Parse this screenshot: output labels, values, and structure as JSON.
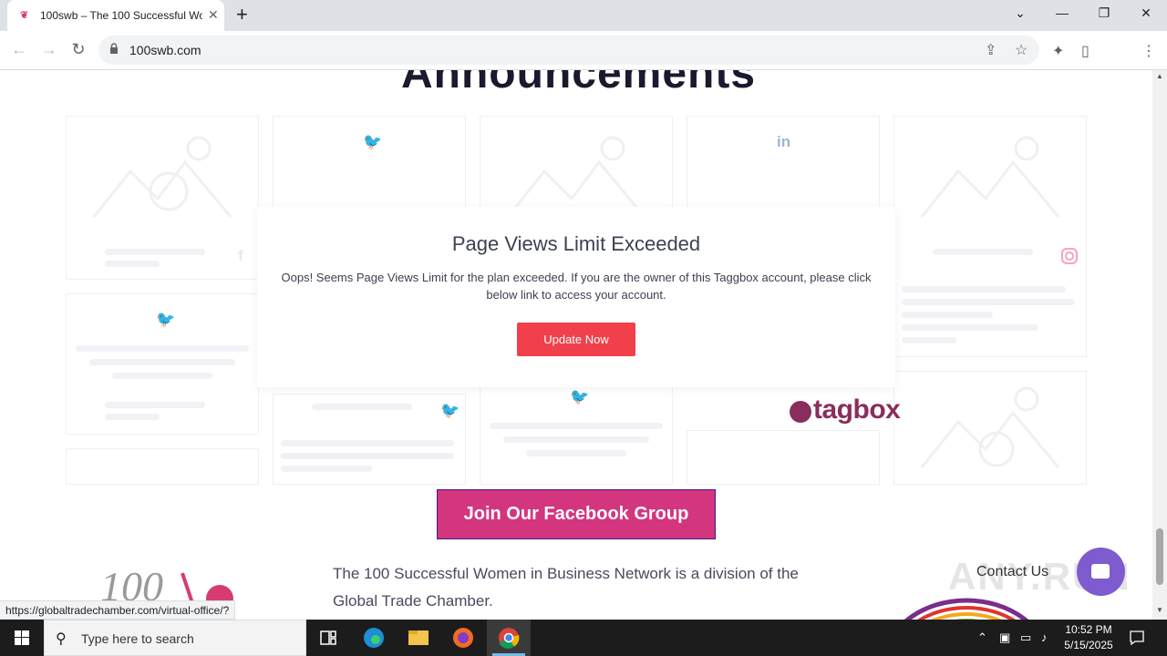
{
  "browser": {
    "tab_title": "100swb – The 100 Successful Wo",
    "tab_close": "✕",
    "new_tab": "+",
    "url": "100swb.com",
    "window": {
      "dropdown": "⌄",
      "minimize": "—",
      "restore": "❐",
      "close": "✕"
    },
    "nav": {
      "back": "←",
      "forward": "→",
      "reload": "↻"
    },
    "toolbar": {
      "share": "⇪",
      "bookmark": "☆",
      "extensions": "✦",
      "sidepanel": "▯",
      "menu": "⋮"
    }
  },
  "page": {
    "heading_fragment": "Announcements",
    "modal": {
      "title": "Page Views Limit Exceeded",
      "message": "Oops! Seems Page Views Limit for the plan exceeded. If you are the owner of this Taggbox account, please click below link to access your account.",
      "button": "Update Now"
    },
    "tagbox_logo": "tagbox",
    "facebook_button": "Join Our Facebook Group",
    "footer_text": "The 100 Successful Women in Business Network is a division of the Global Trade Chamber.",
    "logo_number": "100",
    "contact_label": "Contact Us",
    "watermark": "ANY.RUN",
    "status_url": "https://globaltradechamber.com/virtual-office/?",
    "social_icons": {
      "twitter": "🐦",
      "linkedin": "in",
      "facebook": "f",
      "instagram": "◎"
    }
  },
  "taskbar": {
    "search_placeholder": "Type here to search",
    "time": "10:52 PM",
    "date": "5/15/2025"
  },
  "colors": {
    "accent_red": "#f1404b",
    "facebook_button_bg": "#d3357f",
    "tagbox_brand": "#8a2d5c",
    "chat_bubble": "#7e5bcf"
  }
}
